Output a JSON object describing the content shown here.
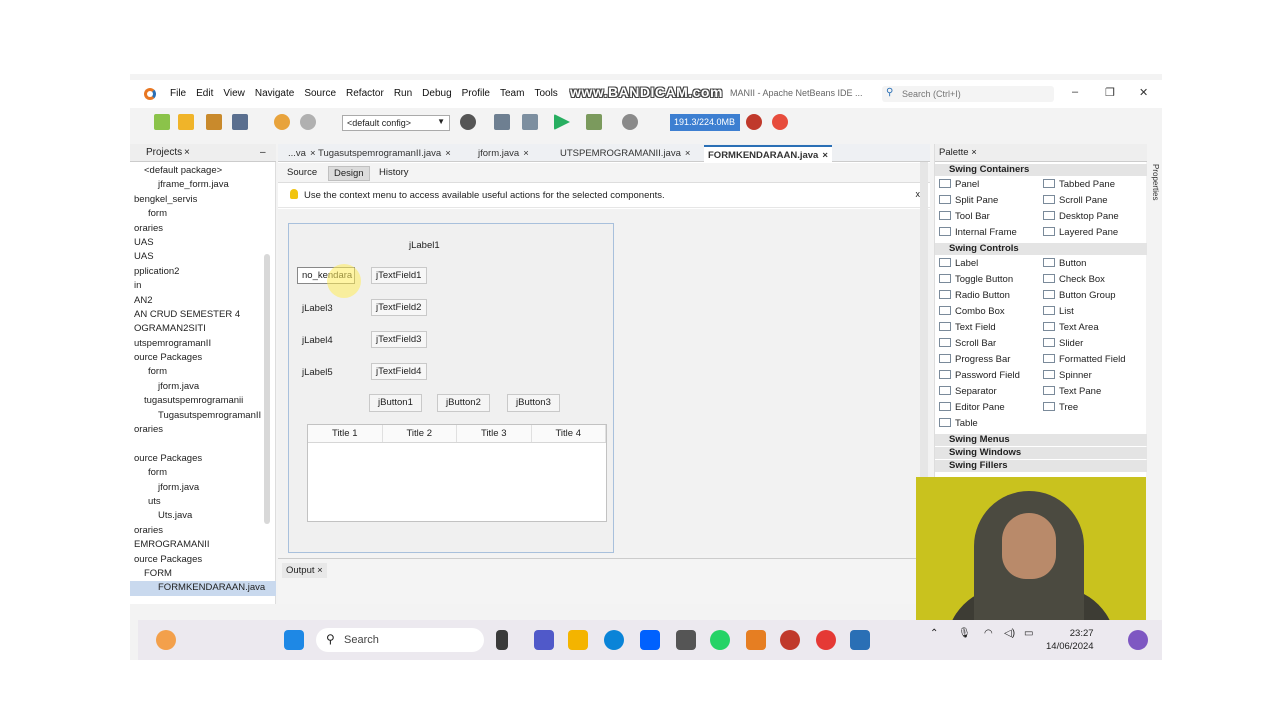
{
  "window": {
    "menu": [
      "File",
      "Edit",
      "View",
      "Navigate",
      "Source",
      "Refactor",
      "Run",
      "Debug",
      "Profile",
      "Team",
      "Tools"
    ],
    "watermark": "www.BANDICAM.com",
    "title_fragment": "MANII - Apache NetBeans IDE ...",
    "search_placeholder": "Search (Ctrl+I)",
    "minimize_glyph": "–",
    "maximize_glyph": "❐",
    "close_glyph": "✕"
  },
  "toolbar": {
    "config_value": "<default config>",
    "memory_label": "191.3/224.0MB"
  },
  "projects": {
    "tab_label": "Projects",
    "tab_close": "×",
    "minimize": "–",
    "tree": [
      "<default package>",
      "jframe_form.java",
      "bengkel_servis",
      "form",
      "oraries",
      "UAS",
      "UAS",
      "pplication2",
      "in",
      "AN2",
      "AN CRUD SEMESTER 4",
      "OGRAMAN2SITI",
      "utspemrogramanII",
      "ource Packages",
      "form",
      "jform.java",
      "tugasutspemrogramanii",
      "TugasutspemrogramanII",
      "oraries",
      "",
      "ource Packages",
      "form",
      "jform.java",
      "uts",
      "Uts.java",
      "oraries",
      "EMROGRAMANII",
      "ource Packages",
      "FORM",
      "FORMKENDARAAN.java"
    ]
  },
  "editor": {
    "tabs": [
      {
        "label": "...va",
        "active": false
      },
      {
        "label": "TugasutspemrogramanII.java",
        "active": false
      },
      {
        "label": "jform.java",
        "active": false
      },
      {
        "label": "UTSPEMROGRAMANII.java",
        "active": false
      },
      {
        "label": "FORMKENDARAAN.java",
        "active": true
      }
    ],
    "tab_close": "×",
    "source_btn": "Source",
    "design_btn": "Design",
    "history_btn": "History",
    "hint": "Use the context menu to access available useful actions for the selected components.",
    "hint_close": "x"
  },
  "form": {
    "title_label": "jLabel1",
    "field_label_editing": "no_kendara",
    "labels": [
      "jLabel3",
      "jLabel4",
      "jLabel5"
    ],
    "fields": [
      "jTextField1",
      "jTextField2",
      "jTextField3",
      "jTextField4"
    ],
    "buttons": [
      "jButton1",
      "jButton2",
      "jButton3"
    ],
    "table_headers": [
      "Title 1",
      "Title 2",
      "Title 3",
      "Title 4"
    ]
  },
  "output": {
    "tab_label": "Output",
    "tab_close": "×"
  },
  "palette": {
    "tab_label": "Palette",
    "tab_close": "×",
    "side_label": "Properties",
    "categories": [
      {
        "name": "Swing Containers",
        "items": [
          "Panel",
          "Tabbed Pane",
          "Split Pane",
          "Scroll Pane",
          "Tool Bar",
          "Desktop Pane",
          "Internal Frame",
          "Layered Pane"
        ]
      },
      {
        "name": "Swing Controls",
        "items": [
          "Label",
          "Button",
          "Toggle Button",
          "Check Box",
          "Radio Button",
          "Button Group",
          "Combo Box",
          "List",
          "Text Field",
          "Text Area",
          "Scroll Bar",
          "Slider",
          "Progress Bar",
          "Formatted Field",
          "Password Field",
          "Spinner",
          "Separator",
          "Text Pane",
          "Editor Pane",
          "Tree",
          "Table"
        ]
      },
      {
        "name": "Swing Menus",
        "items": []
      },
      {
        "name": "Swing Windows",
        "items": []
      },
      {
        "name": "Swing Fillers",
        "items": []
      }
    ]
  },
  "taskbar": {
    "search_label": "Search",
    "time": "23:27",
    "date": "14/06/2024",
    "colors": {
      "windows": "#1e88e5",
      "explorer": "#f4b400",
      "edge": "#0a84d8",
      "whatsapp": "#25d366",
      "chrome": "#e53935"
    }
  }
}
